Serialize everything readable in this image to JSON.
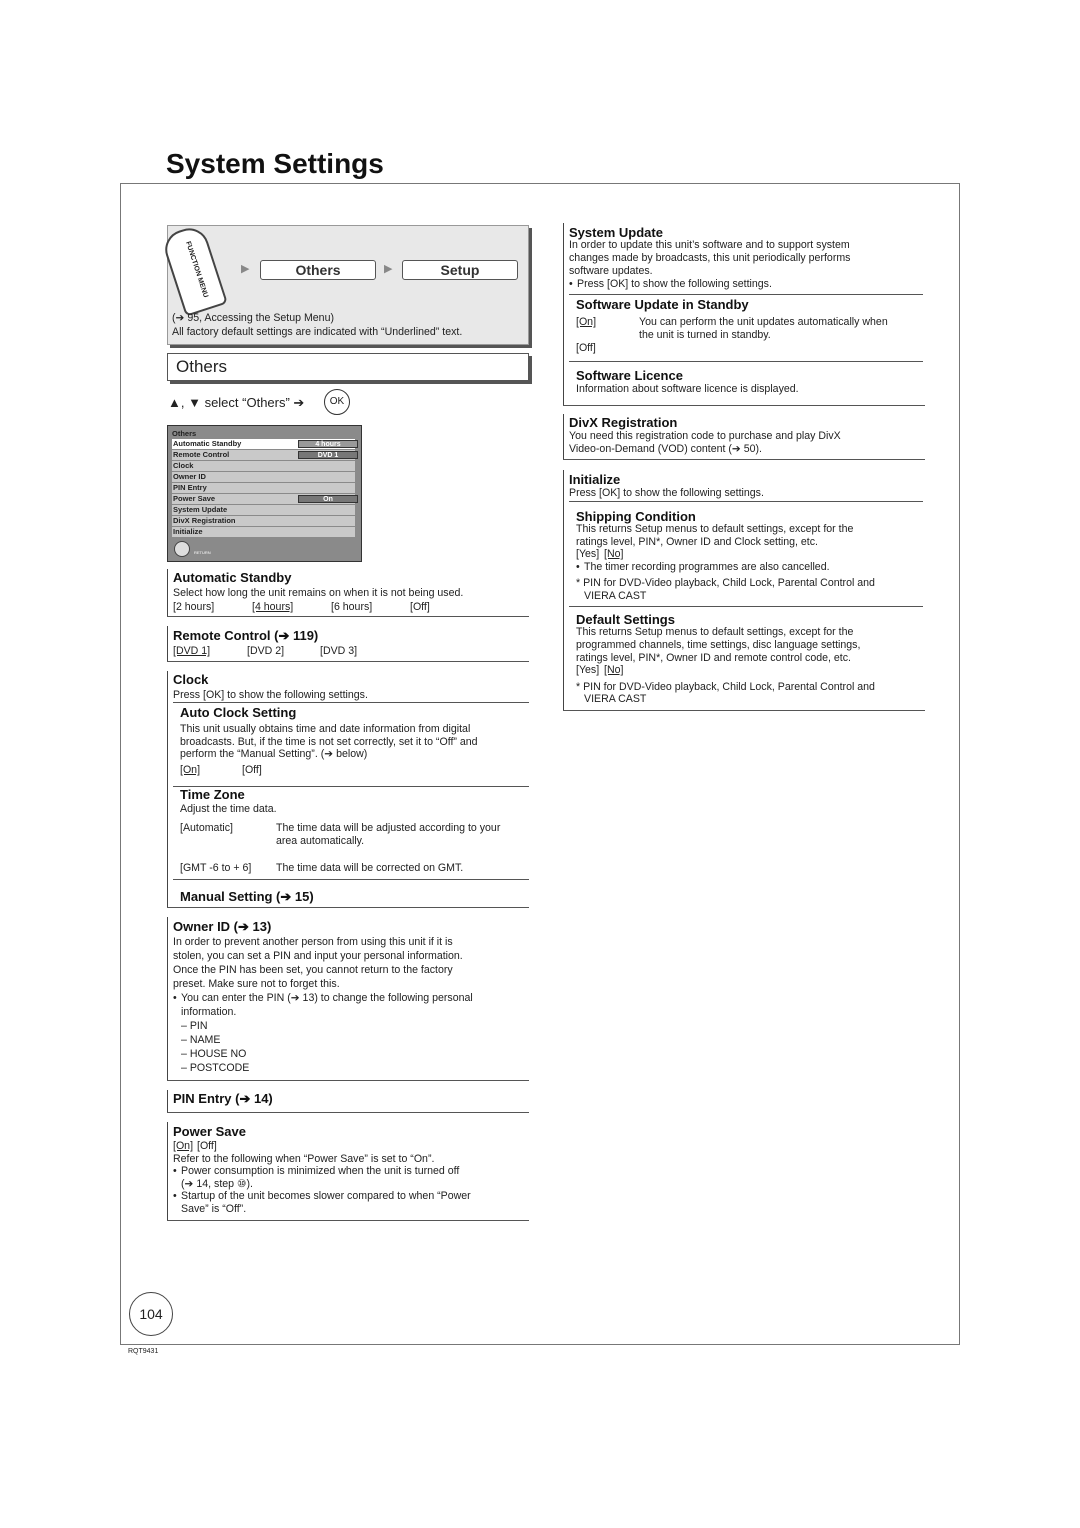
{
  "page_title": "System Settings",
  "nav": {
    "function_menu": "FUNCTION MENU",
    "step1": "Others",
    "step2": "Setup",
    "ref": "(➔ 95, Accessing the Setup Menu)",
    "note": "All factory default settings are indicated with “Underlined” text."
  },
  "section_title": "Others",
  "instruction": {
    "text": "▲, ▼ select “Others” ➔",
    "ok": "OK"
  },
  "screen": {
    "title": "Others",
    "rows": [
      {
        "label": "Automatic Standby",
        "value": "4 hours"
      },
      {
        "label": "Remote Control",
        "value": "DVD 1"
      },
      {
        "label": "Clock"
      },
      {
        "label": "Owner ID"
      },
      {
        "label": "PIN Entry"
      },
      {
        "label": "Power Save",
        "value": "On"
      },
      {
        "label": "System Update"
      },
      {
        "label": "DivX Registration"
      },
      {
        "label": "Initialize"
      }
    ],
    "return": "RETURN"
  },
  "left": {
    "auto_standby": {
      "heading": "Automatic Standby",
      "desc": "Select how long the unit remains on when it is not being used.",
      "options": [
        "[2 hours]",
        "[4 hours]",
        "[6 hours]",
        "[Off]"
      ]
    },
    "remote": {
      "heading": "Remote Control (➔ 119)",
      "options": [
        "[DVD 1]",
        "[DVD 2]",
        "[DVD 3]"
      ]
    },
    "clock": {
      "heading": "Clock",
      "desc": "Press [OK] to show the following settings.",
      "auto": {
        "heading": "Auto Clock Setting",
        "lines": [
          "This unit usually obtains time and date information from digital",
          "broadcasts. But, if the time is not set correctly, set it to “Off” and",
          "perform the “Manual Setting”. (➔ below)"
        ],
        "options": [
          "[On]",
          "[Off]"
        ]
      },
      "tz": {
        "heading": "Time Zone",
        "desc": "Adjust the time data.",
        "rows": [
          {
            "k": "[Automatic]",
            "v1": "The time data will be adjusted according to your",
            "v2": "area automatically."
          },
          {
            "k": "[GMT -6 to + 6]",
            "v1": "The time data will be corrected on GMT."
          }
        ]
      },
      "manual": {
        "heading": "Manual Setting (➔ 15)"
      }
    },
    "owner": {
      "heading": "Owner ID (➔ 13)",
      "lines": [
        "In order to prevent another person from using this unit if it is",
        "stolen, you can set a PIN and input your personal information.",
        "Once the PIN has been set, you cannot return to the factory",
        "preset. Make sure not to forget this."
      ],
      "bullet1": "You can enter the PIN (➔ 13) to change the following personal",
      "bullet2": "information.",
      "items": [
        "– PIN",
        "– NAME",
        "– HOUSE NO",
        "– POSTCODE"
      ]
    },
    "pin": {
      "heading": "PIN Entry (➔ 14)"
    },
    "power": {
      "heading": "Power Save",
      "options": [
        "[On]",
        "[Off]"
      ],
      "desc": "Refer to the following when “Power Save” is set to “On”.",
      "b1a": "Power consumption is minimized when the unit is turned off",
      "b1b": "(➔ 14, step ⑩).",
      "b2a": "Startup of the unit becomes slower compared to when “Power",
      "b2b": "Save” is “Off”."
    }
  },
  "right": {
    "sysupdate": {
      "heading": "System Update",
      "lines": [
        "In order to update this unit’s software and to support system",
        "changes made by broadcasts, this unit periodically performs",
        "software updates."
      ],
      "bullet": "Press [OK] to show the following settings.",
      "standby": {
        "heading": "Software Update in Standby",
        "on": "[On]",
        "on_desc1": "You can perform the unit updates automatically when",
        "on_desc2": "the unit is turned in standby.",
        "off": "[Off]"
      },
      "licence": {
        "heading": "Software Licence",
        "desc": "Information about software licence is displayed."
      }
    },
    "divx": {
      "heading": "DivX Registration",
      "lines": [
        "You need this registration code to purchase and play DivX",
        "Video-on-Demand (VOD) content (➔ 50)."
      ]
    },
    "init": {
      "heading": "Initialize",
      "desc": "Press [OK] to show the following settings.",
      "shipping": {
        "heading": "Shipping Condition",
        "lines": [
          "This returns Setup menus to default settings, except for the",
          "ratings level, PIN*, Owner ID and Clock setting, etc."
        ],
        "yes": "[Yes]",
        "no": "[No]",
        "bullet": "The timer recording programmes are also cancelled.",
        "note1": "* PIN for DVD-Video playback, Child Lock, Parental Control and",
        "note2": "VIERA CAST"
      },
      "default": {
        "heading": "Default Settings",
        "lines": [
          "This returns Setup menus to default settings, except for the",
          "programmed channels, time settings, disc language settings,",
          "ratings level, PIN*, Owner ID and remote control code, etc."
        ],
        "yes": "[Yes]",
        "no": "[No]",
        "note1": "* PIN for DVD-Video playback, Child Lock, Parental Control and",
        "note2": "VIERA CAST"
      }
    }
  },
  "page_number": "104",
  "doc_code": "RQT9431"
}
